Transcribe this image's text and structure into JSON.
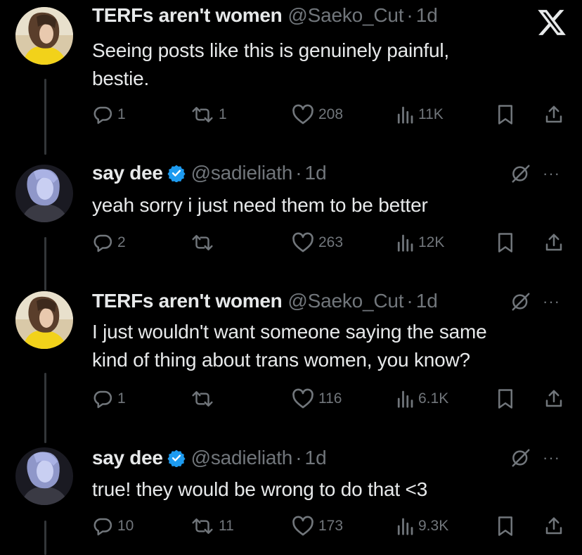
{
  "tweets": [
    {
      "name": "TERFs aren't women",
      "handle": "@Saeko_Cut",
      "dot": "·",
      "time": "1d",
      "verified": false,
      "lines": [
        "Seeing posts like this is genuinely painful,",
        "bestie."
      ],
      "replies": "1",
      "reposts": "1",
      "likes": "208",
      "views": "11K",
      "avatar": "brown-hair-yellow-shirt"
    },
    {
      "name": "say dee",
      "handle": "@sadieliath",
      "dot": "·",
      "time": "1d",
      "verified": true,
      "lines": [
        "yeah sorry i just need them to be better"
      ],
      "replies": "2",
      "reposts": "",
      "likes": "263",
      "views": "12K",
      "avatar": "blue-tinted-portrait"
    },
    {
      "name": "TERFs aren't women",
      "handle": "@Saeko_Cut",
      "dot": "·",
      "time": "1d",
      "verified": false,
      "lines": [
        "I just wouldn't want someone saying the same",
        "kind of thing about trans women, you know?"
      ],
      "replies": "1",
      "reposts": "",
      "likes": "116",
      "views": "6.1K",
      "avatar": "brown-hair-yellow-shirt"
    },
    {
      "name": "say dee",
      "handle": "@sadieliath",
      "dot": "·",
      "time": "1d",
      "verified": true,
      "lines": [
        "true! they would be wrong to do that <3"
      ],
      "replies": "10",
      "reposts": "11",
      "likes": "173",
      "views": "9.3K",
      "avatar": "blue-tinted-portrait"
    }
  ],
  "more_label": "···",
  "icons": {
    "brand": "x-logo-icon",
    "reply": "reply-icon",
    "repost": "repost-icon",
    "like": "heart-icon",
    "views": "views-icon",
    "bookmark": "bookmark-icon",
    "share": "share-icon",
    "grok": "grok-icon"
  },
  "colors": {
    "background": "#000000",
    "text": "#e7e9ea",
    "muted": "#71767b",
    "verified": "#1d9bf0",
    "thread_line": "#333639"
  }
}
